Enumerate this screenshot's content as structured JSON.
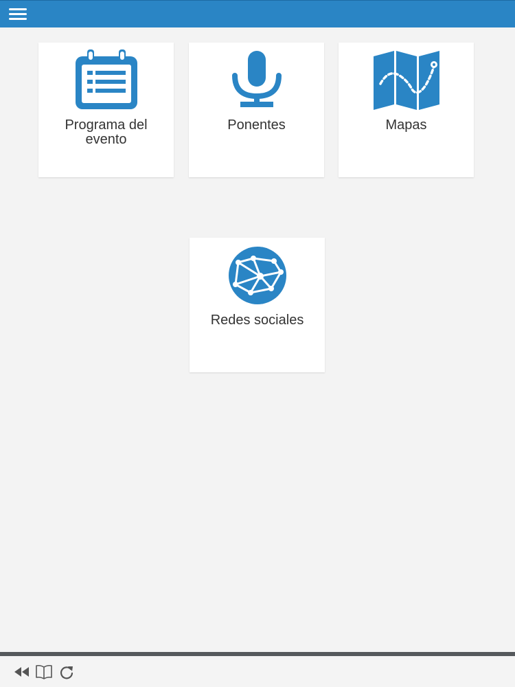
{
  "header": {
    "menu_icon": "hamburger-menu-icon",
    "bar_color": "#2a85c5"
  },
  "tiles": [
    {
      "label": "Programa del evento",
      "icon": "calendar-list-icon"
    },
    {
      "label": "Ponentes",
      "icon": "microphone-icon"
    },
    {
      "label": "Mapas",
      "icon": "folded-map-icon"
    },
    {
      "label": "Redes sociales",
      "icon": "network-globe-icon"
    }
  ],
  "accent_color": "#2a85c5",
  "bottom_toolbar": {
    "icons": [
      "rewind-icon",
      "book-icon",
      "reload-icon"
    ]
  }
}
